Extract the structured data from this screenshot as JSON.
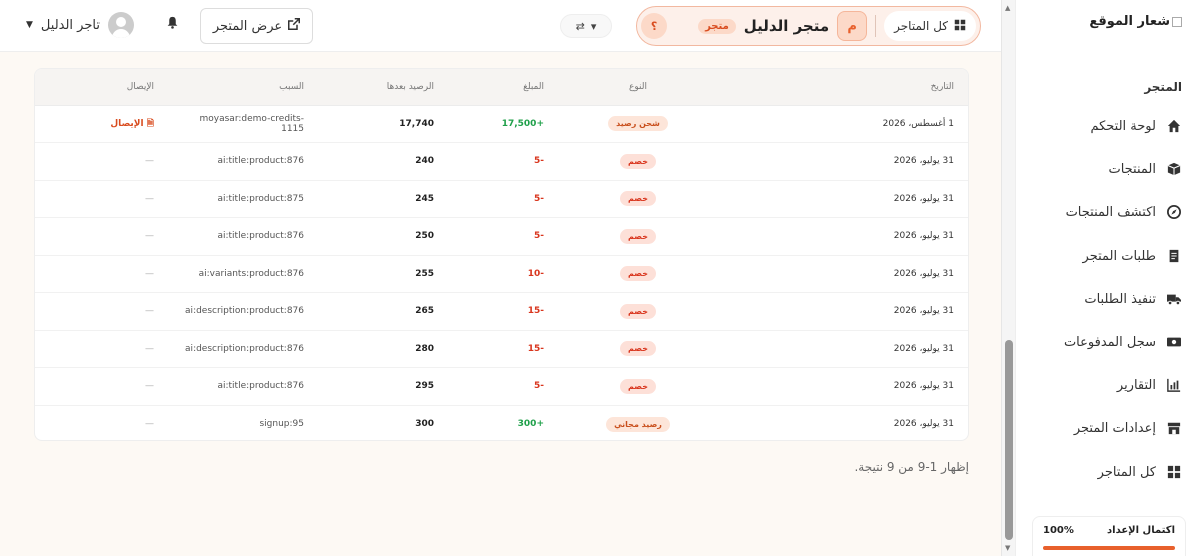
{
  "sidebar": {
    "logo_text": "شعار الموقع",
    "section_title": "المتجر",
    "items": [
      {
        "label": "لوحة التحكم",
        "icon": "home-icon"
      },
      {
        "label": "المنتجات",
        "icon": "box-icon"
      },
      {
        "label": "اكتشف المنتجات",
        "icon": "compass-icon"
      },
      {
        "label": "طلبات المتجر",
        "icon": "receipt-icon"
      },
      {
        "label": "تنفيذ الطلبات",
        "icon": "truck-icon"
      },
      {
        "label": "سجل المدفوعات",
        "icon": "money-icon"
      },
      {
        "label": "التقارير",
        "icon": "chart-icon"
      },
      {
        "label": "إعدادات المتجر",
        "icon": "store-icon"
      },
      {
        "label": "كل المتاجر",
        "icon": "grid-icon"
      }
    ],
    "setup_label": "اكتمال الإعداد",
    "setup_percent": "100%",
    "setup_progress": 1.0
  },
  "header": {
    "all_stores_label": "كل المتاجر",
    "store_initial": "م",
    "store_name": "متجر الدليل",
    "store_badge": "متجر",
    "help_label": "؟",
    "view_store_label": "عرض المتجر",
    "user_name": "تاجر الدليل"
  },
  "table": {
    "headers": [
      "التاريخ",
      "النوع",
      "المبلغ",
      "الرصيد بعدها",
      "السبب",
      "الإيصال"
    ],
    "rows": [
      {
        "date": "1 أغسطس، 2026",
        "type": "شحن رصيد",
        "type_kind": "topup",
        "amount": "+17,500",
        "amount_sign": "pos",
        "balance": "17,740",
        "reason": "moyasar:demo-credits-1115",
        "receipt": "الإيصال",
        "has_receipt": true
      },
      {
        "date": "31 يوليو، 2026",
        "type": "خصم",
        "type_kind": "deduct",
        "amount": "-5",
        "amount_sign": "neg",
        "balance": "240",
        "reason": "ai:title:product:876",
        "receipt": "—",
        "has_receipt": false
      },
      {
        "date": "31 يوليو، 2026",
        "type": "خصم",
        "type_kind": "deduct",
        "amount": "-5",
        "amount_sign": "neg",
        "balance": "245",
        "reason": "ai:title:product:875",
        "receipt": "—",
        "has_receipt": false
      },
      {
        "date": "31 يوليو، 2026",
        "type": "خصم",
        "type_kind": "deduct",
        "amount": "-5",
        "amount_sign": "neg",
        "balance": "250",
        "reason": "ai:title:product:876",
        "receipt": "—",
        "has_receipt": false
      },
      {
        "date": "31 يوليو، 2026",
        "type": "خصم",
        "type_kind": "deduct",
        "amount": "-10",
        "amount_sign": "neg",
        "balance": "255",
        "reason": "ai:variants:product:876",
        "receipt": "—",
        "has_receipt": false
      },
      {
        "date": "31 يوليو، 2026",
        "type": "خصم",
        "type_kind": "deduct",
        "amount": "-15",
        "amount_sign": "neg",
        "balance": "265",
        "reason": "ai:description:product:876",
        "receipt": "—",
        "has_receipt": false
      },
      {
        "date": "31 يوليو، 2026",
        "type": "خصم",
        "type_kind": "deduct",
        "amount": "-15",
        "amount_sign": "neg",
        "balance": "280",
        "reason": "ai:description:product:876",
        "receipt": "—",
        "has_receipt": false
      },
      {
        "date": "31 يوليو، 2026",
        "type": "خصم",
        "type_kind": "deduct",
        "amount": "-5",
        "amount_sign": "neg",
        "balance": "295",
        "reason": "ai:title:product:876",
        "receipt": "—",
        "has_receipt": false
      },
      {
        "date": "31 يوليو، 2026",
        "type": "رصيد مجاني",
        "type_kind": "free",
        "amount": "+300",
        "amount_sign": "pos",
        "balance": "300",
        "reason": "signup:95",
        "receipt": "—",
        "has_receipt": false
      }
    ]
  },
  "pagination_text": "إظهار 1-9 من 9 نتيجة."
}
